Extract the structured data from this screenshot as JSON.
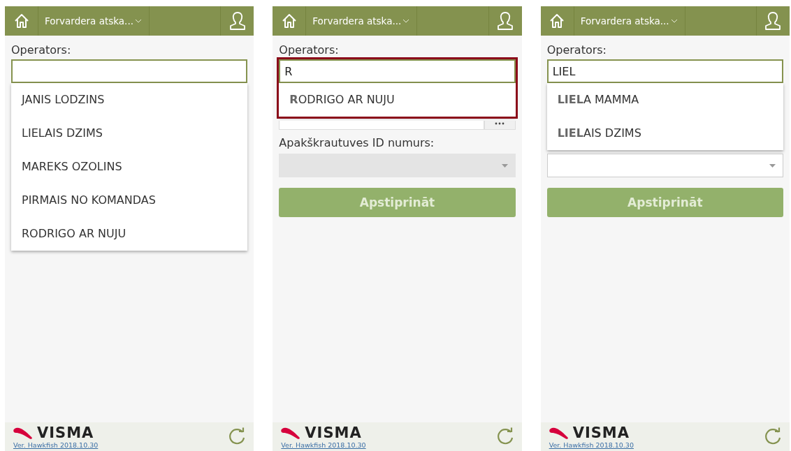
{
  "screens": [
    {
      "header": {
        "title": "Forvardera atska..."
      },
      "operator_label": "Operators:",
      "highlighted": false,
      "suggestions": [
        {
          "text": "JANIS LODZINS"
        },
        {
          "text": "LIELAIS DZIMS"
        },
        {
          "text": "MAREKS OZOLINS"
        },
        {
          "text": "PIRMAIS NO KOMANDAS"
        },
        {
          "text": "RODRIGO AR NUJU"
        }
      ],
      "footer": {
        "logo": "VISMA",
        "version": "Ver. Hawkfish 2018.10.30"
      }
    },
    {
      "header": {
        "title": "Forvardera atska..."
      },
      "operator_label": "Operators:",
      "operator_input": {
        "value": "R"
      },
      "highlighted": true,
      "suggestions": [
        {
          "text": "**R**ODRIGO AR NUJU"
        }
      ],
      "lookup_field_shown": true,
      "sub_store": {
        "label": "Apakškrautuves ID numurs:",
        "disabled": true
      },
      "confirm_button": "Apstiprināt",
      "footer": {
        "logo": "VISMA",
        "version": "Ver. Hawkfish 2018.10.30"
      }
    },
    {
      "header": {
        "title": "Forvardera atska..."
      },
      "operator_label": "Operators:",
      "operator_input": {
        "value": "LIEL"
      },
      "highlighted": false,
      "suggestions": [
        {
          "text": "**LIEL**A MAMMA"
        },
        {
          "text": "**LIEL**AIS DZIMS"
        }
      ],
      "sub_store": {
        "disabled": false
      },
      "confirm_button": "Apstiprināt",
      "footer": {
        "logo": "VISMA",
        "version": "Ver. Hawkfish 2018.10.30"
      }
    }
  ]
}
